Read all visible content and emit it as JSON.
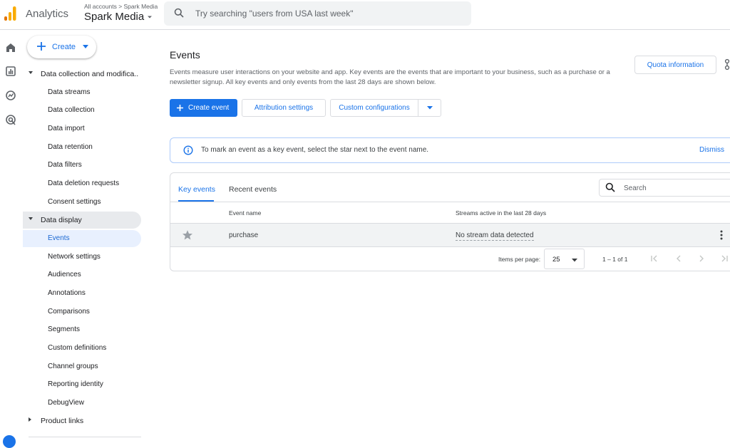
{
  "app": {
    "title": "Analytics",
    "account_crumb": "All accounts > Spark Media",
    "property_name": "Spark Media"
  },
  "search": {
    "placeholder": "Try searching \"users from USA last week\""
  },
  "sidebar": {
    "create_label": "Create",
    "sections": [
      {
        "label": "Data collection and modifica...",
        "expanded": true,
        "items": [
          {
            "label": "Data streams"
          },
          {
            "label": "Data collection"
          },
          {
            "label": "Data import"
          },
          {
            "label": "Data retention"
          },
          {
            "label": "Data filters"
          },
          {
            "label": "Data deletion requests"
          },
          {
            "label": "Consent settings"
          }
        ]
      },
      {
        "label": "Data display",
        "expanded": true,
        "items": [
          {
            "label": "Events",
            "selected": true
          },
          {
            "label": "Network settings"
          },
          {
            "label": "Audiences"
          },
          {
            "label": "Annotations"
          },
          {
            "label": "Comparisons"
          },
          {
            "label": "Segments"
          },
          {
            "label": "Custom definitions"
          },
          {
            "label": "Channel groups"
          },
          {
            "label": "Reporting identity"
          },
          {
            "label": "DebugView"
          }
        ]
      },
      {
        "label": "Product links",
        "expanded": false,
        "items": []
      }
    ]
  },
  "page": {
    "title": "Events",
    "description": "Events measure user interactions on your website and app. Key events are the events that are important to your business, such as a purchase or a newsletter signup. All key events and only events from the last 28 days are shown below.",
    "quota_button": "Quota information"
  },
  "actions": {
    "create_event": "Create event",
    "attribution_settings": "Attribution settings",
    "custom_configurations": "Custom configurations"
  },
  "banner": {
    "message": "To mark an event as a key event, select the star next to the event name.",
    "dismiss": "Dismiss"
  },
  "events_card": {
    "tabs": [
      {
        "label": "Key events",
        "active": true
      },
      {
        "label": "Recent events",
        "active": false
      }
    ],
    "search_placeholder": "Search",
    "columns": {
      "event_name": "Event name",
      "streams_active": "Streams active in the last 28 days"
    },
    "rows": [
      {
        "name": "purchase",
        "streams": "No stream data detected",
        "starred": false
      }
    ],
    "pagination": {
      "items_per_page_label": "Items per page:",
      "items_per_page": "25",
      "range": "1 – 1 of 1"
    }
  },
  "colors": {
    "accent": "#1a73e8",
    "selected_bg": "#e8f0fe",
    "section_active_bg": "#e8eaed",
    "banner_border": "#aecbfa"
  }
}
